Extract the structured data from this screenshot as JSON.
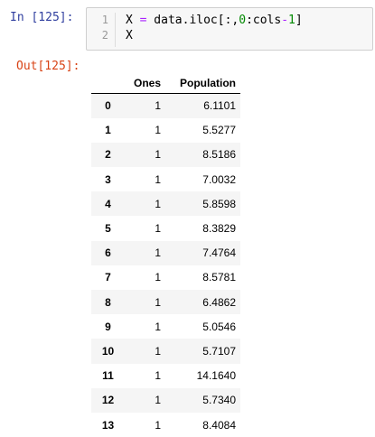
{
  "input_cell": {
    "prompt": "In [125]:",
    "line_numbers": [
      "1",
      "2"
    ],
    "code": {
      "line1": {
        "a": "X ",
        "op1": "=",
        "b": " data.iloc[:,",
        "num0": "0",
        "c": ":cols",
        "op2": "-",
        "num1": "1",
        "d": "]"
      },
      "line2": "X"
    }
  },
  "output_cell": {
    "prompt": "Out[125]:",
    "table": {
      "columns": [
        "",
        "Ones",
        "Population"
      ],
      "rows": [
        {
          "index": "0",
          "ones": "1",
          "population": "6.1101"
        },
        {
          "index": "1",
          "ones": "1",
          "population": "5.5277"
        },
        {
          "index": "2",
          "ones": "1",
          "population": "8.5186"
        },
        {
          "index": "3",
          "ones": "1",
          "population": "7.0032"
        },
        {
          "index": "4",
          "ones": "1",
          "population": "5.8598"
        },
        {
          "index": "5",
          "ones": "1",
          "population": "8.3829"
        },
        {
          "index": "6",
          "ones": "1",
          "population": "7.4764"
        },
        {
          "index": "7",
          "ones": "1",
          "population": "8.5781"
        },
        {
          "index": "8",
          "ones": "1",
          "population": "6.4862"
        },
        {
          "index": "9",
          "ones": "1",
          "population": "5.0546"
        },
        {
          "index": "10",
          "ones": "1",
          "population": "5.7107"
        },
        {
          "index": "11",
          "ones": "1",
          "population": "14.1640"
        },
        {
          "index": "12",
          "ones": "1",
          "population": "5.7340"
        },
        {
          "index": "13",
          "ones": "1",
          "population": "8.4084"
        }
      ]
    }
  },
  "colors": {
    "in_prompt": "#303f9f",
    "out_prompt": "#d84315",
    "operator": "#aa22ff",
    "number": "#008800",
    "cell_background": "#f7f7f7",
    "cell_border": "#cfcfcf",
    "row_stripe": "#f5f5f5"
  }
}
